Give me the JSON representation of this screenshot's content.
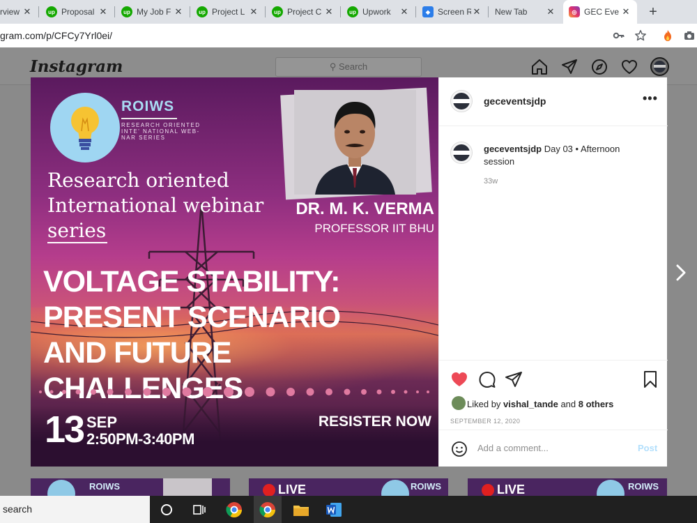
{
  "browser": {
    "tabs": [
      {
        "label": "rview",
        "icon": "blank"
      },
      {
        "label": "Proposal",
        "icon": "upwork-icon"
      },
      {
        "label": "My Job F",
        "icon": "upwork-icon"
      },
      {
        "label": "Project L",
        "icon": "upwork-icon"
      },
      {
        "label": "Project C",
        "icon": "upwork-icon"
      },
      {
        "label": "Upwork",
        "icon": "upwork-icon"
      },
      {
        "label": "Screen R",
        "icon": "screen-recorder-icon"
      },
      {
        "label": "New Tab",
        "icon": "blank"
      },
      {
        "label": "GEC Eve",
        "icon": "instagram-icon"
      }
    ],
    "active_tab_index": 8,
    "close_glyph": "✕",
    "new_tab_glyph": "+",
    "address": "gram.com/p/CFCy7Yrl0ei/"
  },
  "instagram": {
    "logo": "Instagram",
    "search_placeholder": "Search"
  },
  "post_image": {
    "brand": "ROIWS",
    "brand_sub": "Research Oriented Inte' National Web-Nar Series",
    "title_lines": [
      "Research oriented",
      "International webinar",
      "series"
    ],
    "speaker_name": "DR. M. K. VERMA",
    "speaker_role": "PROFESSOR IIT BHU",
    "headline_lines": [
      "VOLTAGE STABILITY:",
      "PRESENT SCENARIO",
      "AND FUTURE CHALLENGES"
    ],
    "date_day": "13",
    "date_month": "SEP",
    "date_time": "2:50PM-3:40PM",
    "register": "RESISTER NOW"
  },
  "post_panel": {
    "username": "geceventsjdp",
    "more_glyph": "•••",
    "caption_user": "geceventsjdp",
    "caption_text": "Day 03 • Afternoon session",
    "age": "33w",
    "liked_prefix": "Liked by",
    "liked_user": "vishal_tande",
    "liked_suffix": "and",
    "liked_others": "8 others",
    "date": "SEPTEMBER 12, 2020",
    "comment_placeholder": "Add a comment...",
    "post_label": "Post"
  },
  "thumbnails": [
    {
      "label": "ROIWS"
    },
    {
      "label": "ROIWS"
    },
    {
      "label": "ROIWS"
    }
  ],
  "taskbar": {
    "search_text": "search"
  },
  "colors": {
    "like_red": "#ed4956",
    "upwork_green": "#14a800",
    "post_blue": "#b2dffc"
  }
}
